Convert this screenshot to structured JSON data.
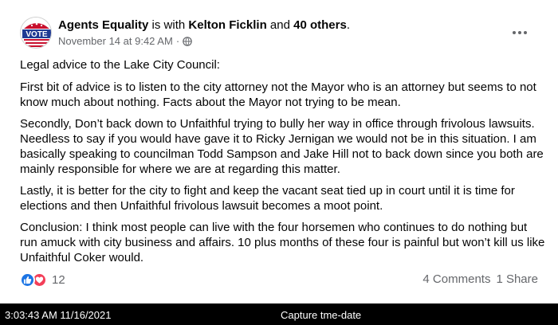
{
  "post": {
    "author": "Agents Equality",
    "with_text": "is with",
    "tagged_person": "Kelton Ficklin",
    "and_text": "and",
    "others": "40 others",
    "period": ".",
    "timestamp": "November 14 at 9:42 AM",
    "separator": "·",
    "privacy_icon": "globe-icon",
    "avatar_text": "VOTE",
    "paragraphs": [
      "Legal advice to the Lake City Council:",
      "First bit of advice is to listen to the city attorney not the Mayor who is an attorney but seems to not know much about nothing. Facts about the Mayor not trying to be mean.",
      "Secondly, Don’t back down to Unfaithful trying to bully her way in office through frivolous lawsuits. Needless to say if you would have gave it to Ricky Jernigan we would not be in this situation. I am basically speaking to councilman Todd Sampson and Jake Hill not to back down since you both are mainly responsible for where we are at regarding this matter.",
      "Lastly, it is better for the city to fight and keep the vacant seat tied up in court until it is time for elections and then Unfaithful frivolous lawsuit becomes a moot point.",
      "Conclusion: I think most people can live with the four horsemen who continues to do nothing but run amuck with city business and affairs. 10 plus months of these four is painful but won’t kill us like Unfaithful Coker would."
    ],
    "reaction_count": "12",
    "comments": "4 Comments",
    "shares": "1 Share",
    "colors": {
      "like": "#1b74e4",
      "love": "#f33e58",
      "muted": "#65676b"
    }
  },
  "capture": {
    "timestamp": "3:03:43 AM 11/16/2021",
    "label": "Capture tme-date"
  }
}
